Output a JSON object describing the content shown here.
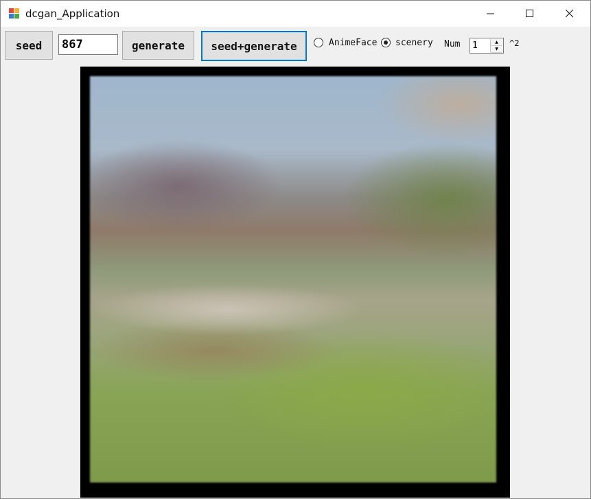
{
  "window": {
    "title": "dcgan_Application",
    "minimize_glyph": "—",
    "maximize_glyph": "☐",
    "close_glyph": "✕"
  },
  "toolbar": {
    "seed_label": "seed",
    "seed_value": "867",
    "generate_label": "generate",
    "seed_generate_label": "seed+generate",
    "radio_animeface_label": "AnimeFace",
    "radio_scenery_label": "scenery",
    "selected_mode": "scenery",
    "num_label": "Num",
    "num_value": "1",
    "num_suffix": "^2"
  },
  "icons": {
    "app": "app-icon",
    "spin_up": "chevron-up-icon",
    "spin_down": "chevron-down-icon"
  },
  "colors": {
    "focus_border": "#0078d7",
    "window_bg": "#f0f0f0"
  }
}
